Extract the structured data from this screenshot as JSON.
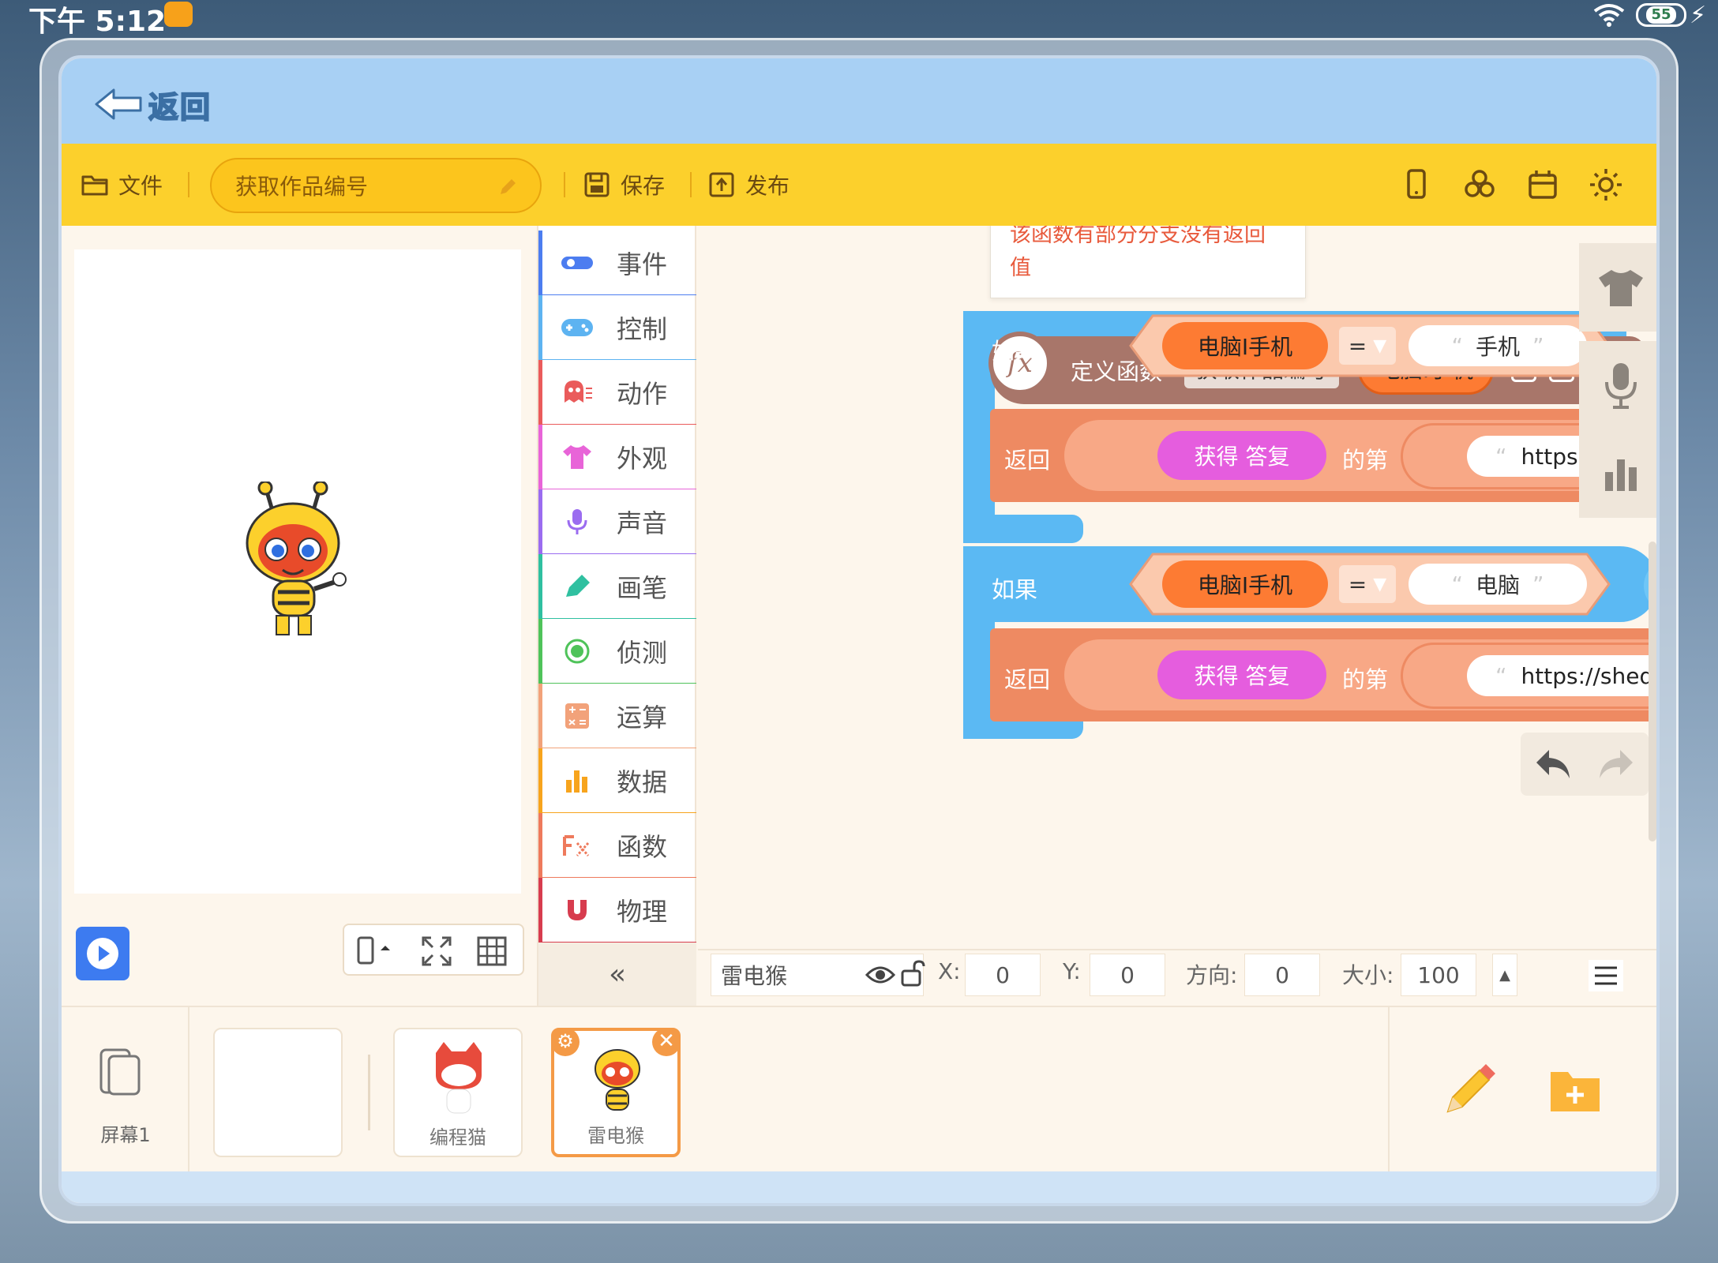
{
  "status": {
    "time": "下午 5:12",
    "battery": "55"
  },
  "header": {
    "back_label": "返回"
  },
  "toolbar": {
    "file_label": "文件",
    "project_name": "获取作品编号",
    "save_label": "保存",
    "publish_label": "发布"
  },
  "categories": [
    {
      "label": "事件",
      "color": "#4c7df0"
    },
    {
      "label": "控制",
      "color": "#5db3f1"
    },
    {
      "label": "动作",
      "color": "#ea5b5b"
    },
    {
      "label": "外观",
      "color": "#e864d8"
    },
    {
      "label": "声音",
      "color": "#9b6cf0"
    },
    {
      "label": "画笔",
      "color": "#2fc0a0"
    },
    {
      "label": "侦测",
      "color": "#4fc35a"
    },
    {
      "label": "运算",
      "color": "#f2a27a"
    },
    {
      "label": "数据",
      "color": "#f7a41d"
    },
    {
      "label": "函数",
      "color": "#ee7a5c"
    },
    {
      "label": "物理",
      "color": "#d73c4e"
    }
  ],
  "collapse_label": "«",
  "workspace": {
    "tooltip": "该函数有部分分支没有返回值",
    "fx_label": "fx",
    "define_label": "定义函数",
    "func_name": "获取作品编号",
    "param_name": "电脑I手机",
    "if_label": "如果",
    "eq_label": "=",
    "return_label": "返回",
    "answer_label": "获得 答复",
    "nth_label": "的第",
    "open_quote": "“",
    "close_quote": "”",
    "branch1": {
      "param": "电脑I手机",
      "value": "手机",
      "url": "https://ne"
    },
    "branch2": {
      "param": "电脑I手机",
      "value": "电脑",
      "url": "https://shequ.code"
    }
  },
  "propbar": {
    "sprite_name": "雷电猴",
    "x_label": "X:",
    "x_value": "0",
    "y_label": "Y:",
    "y_value": "0",
    "dir_label": "方向:",
    "dir_value": "0",
    "size_label": "大小:",
    "size_value": "100"
  },
  "bottom": {
    "screen_label": "屏幕1",
    "sprites": [
      {
        "name": "编程猫"
      },
      {
        "name": "雷电猴"
      }
    ]
  },
  "colors": {
    "toolbar_yellow": "#fcd02c",
    "func_brown": "#a8766a",
    "control_blue": "#5bb9f3",
    "func_orange": "#f08e6a",
    "param_orange": "#fd7b33",
    "look_magenta": "#e55dde"
  }
}
